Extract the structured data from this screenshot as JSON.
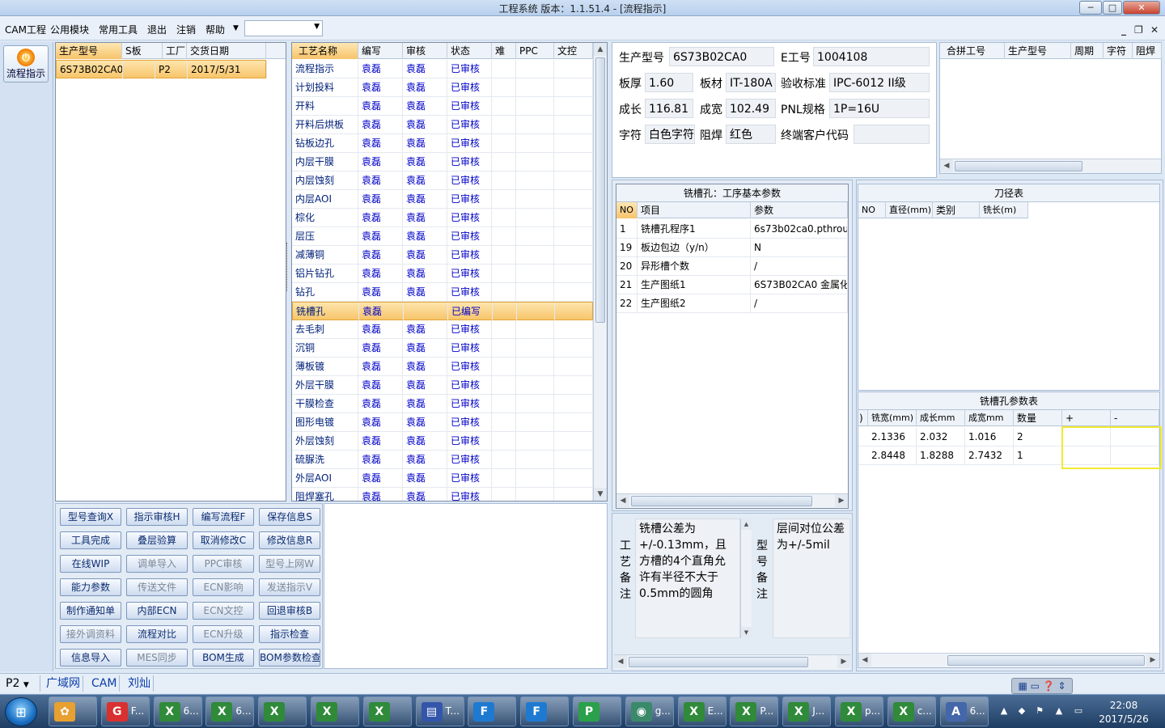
{
  "window": {
    "title": "工程系统   版本：1.1.51.4 - [流程指示]"
  },
  "menu": {
    "items": [
      "CAM工程",
      "公用模块",
      "常用工具",
      "退出",
      "注销",
      "帮助"
    ],
    "combo_value": ""
  },
  "leftbar": {
    "button_label": "流程指示"
  },
  "order_table": {
    "headers": [
      "生产型号",
      "S板",
      "工厂",
      "交货日期"
    ],
    "rows": [
      {
        "model": "6S73B02CA0",
        "s": "",
        "factory": "P2",
        "date": "2017/5/31"
      }
    ]
  },
  "process_table": {
    "headers": [
      "工艺名称",
      "编写",
      "审核",
      "状态",
      "难",
      "PPC",
      "文控"
    ],
    "rows": [
      {
        "name": "流程指示",
        "writer": "袁磊",
        "reviewer": "袁磊",
        "status": "已审核"
      },
      {
        "name": "计划投料",
        "writer": "袁磊",
        "reviewer": "袁磊",
        "status": "已审核"
      },
      {
        "name": "开料",
        "writer": "袁磊",
        "reviewer": "袁磊",
        "status": "已审核"
      },
      {
        "name": "开料后烘板",
        "writer": "袁磊",
        "reviewer": "袁磊",
        "status": "已审核"
      },
      {
        "name": "钻板边孔",
        "writer": "袁磊",
        "reviewer": "袁磊",
        "status": "已审核"
      },
      {
        "name": "内层干膜",
        "writer": "袁磊",
        "reviewer": "袁磊",
        "status": "已审核"
      },
      {
        "name": "内层蚀刻",
        "writer": "袁磊",
        "reviewer": "袁磊",
        "status": "已审核"
      },
      {
        "name": "内层AOI",
        "writer": "袁磊",
        "reviewer": "袁磊",
        "status": "已审核"
      },
      {
        "name": "棕化",
        "writer": "袁磊",
        "reviewer": "袁磊",
        "status": "已审核"
      },
      {
        "name": "层压",
        "writer": "袁磊",
        "reviewer": "袁磊",
        "status": "已审核"
      },
      {
        "name": "减薄铜",
        "writer": "袁磊",
        "reviewer": "袁磊",
        "status": "已审核"
      },
      {
        "name": "铝片钻孔",
        "writer": "袁磊",
        "reviewer": "袁磊",
        "status": "已审核"
      },
      {
        "name": "钻孔",
        "writer": "袁磊",
        "reviewer": "袁磊",
        "status": "已审核"
      },
      {
        "name": "铣槽孔",
        "writer": "袁磊",
        "reviewer": "",
        "status": "已编写"
      },
      {
        "name": "去毛刺",
        "writer": "袁磊",
        "reviewer": "袁磊",
        "status": "已审核"
      },
      {
        "name": "沉铜",
        "writer": "袁磊",
        "reviewer": "袁磊",
        "status": "已审核"
      },
      {
        "name": "薄板镀",
        "writer": "袁磊",
        "reviewer": "袁磊",
        "status": "已审核"
      },
      {
        "name": "外层干膜",
        "writer": "袁磊",
        "reviewer": "袁磊",
        "status": "已审核"
      },
      {
        "name": "干膜检查",
        "writer": "袁磊",
        "reviewer": "袁磊",
        "status": "已审核"
      },
      {
        "name": "图形电镀",
        "writer": "袁磊",
        "reviewer": "袁磊",
        "status": "已审核"
      },
      {
        "name": "外层蚀刻",
        "writer": "袁磊",
        "reviewer": "袁磊",
        "status": "已审核"
      },
      {
        "name": "硫脲洗",
        "writer": "袁磊",
        "reviewer": "袁磊",
        "status": "已审核"
      },
      {
        "name": "外层AOI",
        "writer": "袁磊",
        "reviewer": "袁磊",
        "status": "已审核"
      },
      {
        "name": "阻焊塞孔",
        "writer": "袁磊",
        "reviewer": "袁磊",
        "status": "已审核"
      }
    ]
  },
  "actions": {
    "rows": [
      [
        "型号查询X",
        "指示审核H",
        "编写流程F",
        "保存信息S"
      ],
      [
        "工具完成",
        "叠层验算",
        "取消修改C",
        "修改信息R"
      ],
      [
        "在线WIP",
        "调单导入",
        "PPC审核",
        "型号上网W"
      ],
      [
        "能力参数",
        "传送文件",
        "ECN影响",
        "发送指示V"
      ],
      [
        "制作通知单",
        "内部ECN",
        "ECN文控",
        "回退审核B"
      ],
      [
        "接外调资料",
        "流程对比",
        "ECN升级",
        "指示检查"
      ],
      [
        "信息导入",
        "MES同步",
        "BOM生成",
        "BOM参数检查"
      ]
    ]
  },
  "info": {
    "model_label": "生产型号",
    "model": "6S73B02CA0",
    "eng_no_label": "E工号",
    "eng_no": "1004108",
    "thickness_label": "板厚",
    "thickness": "1.60",
    "material_label": "板材",
    "material": "IT-180A",
    "standard_label": "验收标准",
    "standard": "IPC-6012 II级",
    "length_label": "成长",
    "length": "116.81",
    "width_label": "成宽",
    "width": "102.49",
    "pnl_label": "PNL规格",
    "pnl": "1P=16U",
    "legend_label": "字符",
    "legend": "白色字符",
    "mask_label": "阻焊",
    "mask": "红色",
    "customer_label": "终端客户代码",
    "customer": ""
  },
  "merge_table": {
    "headers": [
      "合拼工号",
      "生产型号",
      "周期",
      "字符",
      "阻焊"
    ]
  },
  "params": {
    "title": "铣槽孔：工序基本参数",
    "headers": [
      "NO",
      "项目",
      "参数"
    ],
    "rows": [
      {
        "no": "1",
        "item": "铣槽孔程序1",
        "value": "6s73b02ca0.pthrou"
      },
      {
        "no": "19",
        "item": "板边包边（y/n）",
        "value": "N"
      },
      {
        "no": "20",
        "item": "异形槽个数",
        "value": "/"
      },
      {
        "no": "21",
        "item": "生产图纸1",
        "value": "6S73B02CA0 金属化"
      },
      {
        "no": "22",
        "item": "生产图纸2",
        "value": "/"
      }
    ]
  },
  "tools": {
    "title": "刀径表",
    "headers": [
      "NO",
      "直径(mm)",
      "类别",
      "铣长(m)"
    ]
  },
  "slot_params": {
    "title": "铣槽孔参数表",
    "headers": [
      ")",
      "铣宽(mm)",
      "成长mm",
      "成宽mm",
      "数量",
      "+",
      "-"
    ],
    "rows": [
      {
        "w": "2.1336",
        "l": "2.032",
        "cw": "1.016",
        "qty": "2",
        "plus": "",
        "minus": ""
      },
      {
        "w": "2.8448",
        "l": "1.8288",
        "cw": "2.7432",
        "qty": "1",
        "plus": "",
        "minus": ""
      }
    ]
  },
  "notes": {
    "process_label": "工艺备注",
    "process_note": "铣槽公差为+/-0.13mm，且方槽的4个直角允许有半径不大于0.5mm的圆角",
    "model_label": "型号备注",
    "model_note": "层间对位公差为+/-5mil"
  },
  "statusbar": {
    "factory": "P2",
    "tabs": [
      "广域网",
      "CAM",
      "刘灿"
    ]
  },
  "taskbar": {
    "items": [
      "",
      "F...",
      "6...",
      "6...",
      "",
      "",
      "",
      "T...",
      "",
      "",
      "",
      "g...",
      "E...",
      "P...",
      "J...",
      "p...",
      "c...",
      "6..."
    ],
    "time": "22:08",
    "date": "2017/5/26"
  },
  "colors": {
    "selected_row": "#f8c56b",
    "link_blue": "#0000c8",
    "highlight": "#f2ea31"
  }
}
